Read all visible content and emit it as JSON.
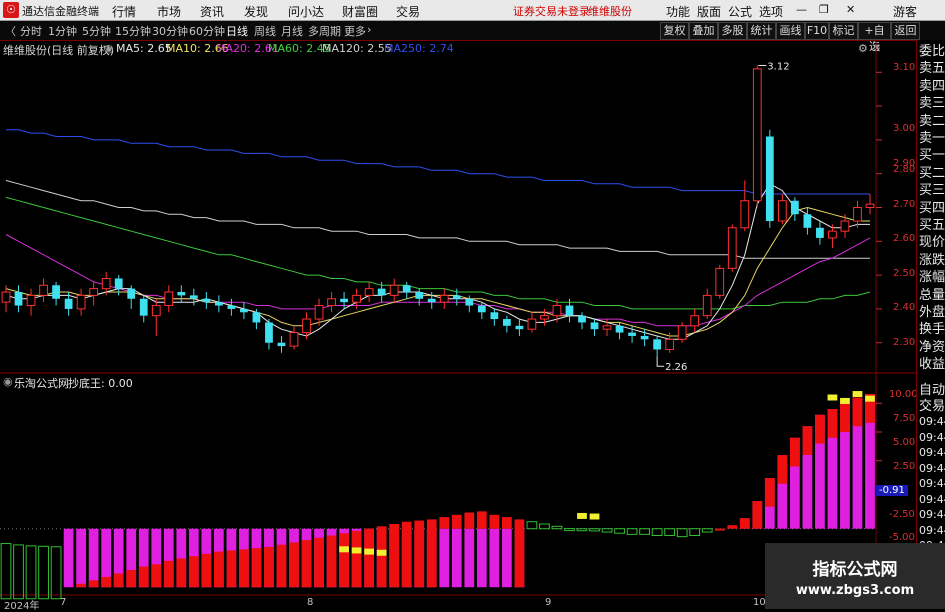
{
  "app": {
    "title": "通达信金融终端",
    "menus": [
      "行情",
      "市场",
      "资讯",
      "发现",
      "问小达",
      "财富圈",
      "交易"
    ],
    "warning": "证券交易未登录",
    "stock_name_top": "维维股份",
    "right_menus": [
      "功能",
      "版面",
      "公式",
      "选项"
    ],
    "user": "游客"
  },
  "toolbar": {
    "periods": [
      "分时",
      "1分钟",
      "5分钟",
      "15分钟",
      "30分钟",
      "60分钟",
      "日线",
      "周线",
      "月线",
      "多周期",
      "更多"
    ],
    "active": "日线",
    "buttons": [
      "复权",
      "叠加",
      "多股",
      "统计",
      "画线",
      "F10",
      "标记",
      "+自选",
      "返回"
    ]
  },
  "main_chart": {
    "header": "维维股份(日线 前复权)",
    "ma": [
      {
        "label": "MA5: 2.65",
        "color": "#e8e8e8"
      },
      {
        "label": "MA10: 2.66",
        "color": "#f0e060"
      },
      {
        "label": "MA20: 2.61",
        "color": "#e030e0"
      },
      {
        "label": "MA60: 2.45",
        "color": "#40d040"
      },
      {
        "label": "MA120: 2.55",
        "color": "#d0d0d0"
      },
      {
        "label": "MA250: 2.74",
        "color": "#3050f0"
      }
    ],
    "high_label": "3.12",
    "low_label": "2.26",
    "y_ticks": [
      "3.10",
      "3.00",
      "2.90",
      "2.80",
      "2.70",
      "2.60",
      "2.50",
      "2.40",
      "2.30"
    ]
  },
  "sub_chart": {
    "header_name": "乐淘公式网",
    "indicator": "抄底王: 0.00",
    "y_ticks": [
      "10.00",
      "7.50",
      "5.00",
      "2.50",
      "-0.91",
      "-2.50",
      "-5.00"
    ]
  },
  "x_axis": [
    "2024年",
    "7",
    "8",
    "9",
    "10"
  ],
  "right_panel": {
    "top_items": [
      "委比",
      "卖五",
      "卖四",
      "卖三",
      "卖二",
      "卖一",
      "买一",
      "买二",
      "买三",
      "买四",
      "买五",
      "现价",
      "涨跌",
      "涨幅",
      "总量",
      "外盘",
      "换手",
      "净资",
      "收益"
    ],
    "bottom_items": [
      "自动",
      "交易",
      "09:44",
      "09:44",
      "09:44",
      "09:44",
      "09:44",
      "09:44",
      "09:44",
      "09:44",
      "09:44"
    ]
  },
  "watermark": {
    "line1": "指标公式网",
    "line2": "www.zbgs3.com"
  },
  "chart_data": {
    "type": "candlestick",
    "title": "维维股份(日线 前复权)",
    "ylim": [
      2.24,
      3.16
    ],
    "candles": [
      [
        2.42,
        2.45,
        2.39,
        2.47
      ],
      [
        2.45,
        2.41,
        2.39,
        2.47
      ],
      [
        2.41,
        2.44,
        2.38,
        2.46
      ],
      [
        2.44,
        2.47,
        2.42,
        2.49
      ],
      [
        2.47,
        2.43,
        2.41,
        2.48
      ],
      [
        2.43,
        2.4,
        2.38,
        2.45
      ],
      [
        2.4,
        2.44,
        2.38,
        2.46
      ],
      [
        2.44,
        2.46,
        2.41,
        2.48
      ],
      [
        2.46,
        2.49,
        2.44,
        2.51
      ],
      [
        2.49,
        2.46,
        2.44,
        2.5
      ],
      [
        2.46,
        2.43,
        2.4,
        2.47
      ],
      [
        2.43,
        2.38,
        2.36,
        2.44
      ],
      [
        2.38,
        2.41,
        2.32,
        2.43
      ],
      [
        2.41,
        2.45,
        2.39,
        2.47
      ],
      [
        2.45,
        2.44,
        2.42,
        2.47
      ],
      [
        2.44,
        2.43,
        2.41,
        2.46
      ],
      [
        2.43,
        2.42,
        2.4,
        2.45
      ],
      [
        2.42,
        2.41,
        2.39,
        2.44
      ],
      [
        2.41,
        2.4,
        2.38,
        2.43
      ],
      [
        2.4,
        2.39,
        2.37,
        2.42
      ],
      [
        2.39,
        2.36,
        2.34,
        2.4
      ],
      [
        2.36,
        2.3,
        2.28,
        2.37
      ],
      [
        2.3,
        2.29,
        2.27,
        2.32
      ],
      [
        2.29,
        2.33,
        2.28,
        2.35
      ],
      [
        2.33,
        2.37,
        2.31,
        2.39
      ],
      [
        2.37,
        2.41,
        2.35,
        2.43
      ],
      [
        2.41,
        2.43,
        2.39,
        2.45
      ],
      [
        2.43,
        2.42,
        2.4,
        2.45
      ],
      [
        2.42,
        2.44,
        2.4,
        2.46
      ],
      [
        2.44,
        2.46,
        2.42,
        2.48
      ],
      [
        2.46,
        2.44,
        2.42,
        2.48
      ],
      [
        2.44,
        2.47,
        2.42,
        2.49
      ],
      [
        2.47,
        2.45,
        2.43,
        2.48
      ],
      [
        2.45,
        2.43,
        2.41,
        2.46
      ],
      [
        2.43,
        2.42,
        2.4,
        2.45
      ],
      [
        2.42,
        2.44,
        2.4,
        2.46
      ],
      [
        2.44,
        2.43,
        2.41,
        2.46
      ],
      [
        2.43,
        2.41,
        2.39,
        2.44
      ],
      [
        2.41,
        2.39,
        2.37,
        2.42
      ],
      [
        2.39,
        2.37,
        2.35,
        2.4
      ],
      [
        2.37,
        2.35,
        2.33,
        2.38
      ],
      [
        2.35,
        2.34,
        2.32,
        2.37
      ],
      [
        2.34,
        2.37,
        2.33,
        2.39
      ],
      [
        2.37,
        2.38,
        2.35,
        2.4
      ],
      [
        2.38,
        2.41,
        2.36,
        2.43
      ],
      [
        2.41,
        2.38,
        2.36,
        2.43
      ],
      [
        2.38,
        2.36,
        2.34,
        2.39
      ],
      [
        2.36,
        2.34,
        2.32,
        2.37
      ],
      [
        2.34,
        2.35,
        2.32,
        2.37
      ],
      [
        2.35,
        2.33,
        2.31,
        2.36
      ],
      [
        2.33,
        2.32,
        2.3,
        2.35
      ],
      [
        2.32,
        2.31,
        2.29,
        2.34
      ],
      [
        2.31,
        2.28,
        2.26,
        2.32
      ],
      [
        2.28,
        2.31,
        2.27,
        2.33
      ],
      [
        2.31,
        2.35,
        2.3,
        2.36
      ],
      [
        2.35,
        2.38,
        2.33,
        2.4
      ],
      [
        2.38,
        2.44,
        2.37,
        2.46
      ],
      [
        2.44,
        2.52,
        2.43,
        2.53
      ],
      [
        2.52,
        2.64,
        2.51,
        2.65
      ],
      [
        2.64,
        2.72,
        2.63,
        2.78
      ],
      [
        2.72,
        3.11,
        2.7,
        3.12
      ],
      [
        2.91,
        2.66,
        2.64,
        2.93
      ],
      [
        2.66,
        2.72,
        2.65,
        2.74
      ],
      [
        2.72,
        2.68,
        2.66,
        2.73
      ],
      [
        2.68,
        2.64,
        2.62,
        2.7
      ],
      [
        2.64,
        2.61,
        2.59,
        2.66
      ],
      [
        2.61,
        2.63,
        2.58,
        2.65
      ],
      [
        2.63,
        2.66,
        2.61,
        2.68
      ],
      [
        2.66,
        2.7,
        2.64,
        2.72
      ],
      [
        2.7,
        2.71,
        2.68,
        2.74
      ]
    ],
    "series": [
      {
        "name": "MA250",
        "values": [
          2.93,
          2.93,
          2.92,
          2.92,
          2.91,
          2.91,
          2.91,
          2.9,
          2.9,
          2.9,
          2.89,
          2.89,
          2.89,
          2.88,
          2.88,
          2.88,
          2.87,
          2.87,
          2.87,
          2.86,
          2.86,
          2.86,
          2.85,
          2.85,
          2.85,
          2.84,
          2.84,
          2.84,
          2.83,
          2.83,
          2.83,
          2.82,
          2.82,
          2.82,
          2.81,
          2.81,
          2.81,
          2.8,
          2.8,
          2.8,
          2.79,
          2.79,
          2.79,
          2.78,
          2.78,
          2.78,
          2.78,
          2.77,
          2.77,
          2.77,
          2.76,
          2.76,
          2.76,
          2.76,
          2.75,
          2.75,
          2.75,
          2.75,
          2.75,
          2.75,
          2.74,
          2.74,
          2.74,
          2.74,
          2.74,
          2.74,
          2.74,
          2.74,
          2.74,
          2.74
        ]
      },
      {
        "name": "MA120",
        "values": [
          2.78,
          2.77,
          2.76,
          2.75,
          2.74,
          2.73,
          2.72,
          2.72,
          2.71,
          2.7,
          2.7,
          2.69,
          2.69,
          2.68,
          2.68,
          2.67,
          2.67,
          2.66,
          2.66,
          2.66,
          2.65,
          2.65,
          2.65,
          2.64,
          2.64,
          2.64,
          2.63,
          2.63,
          2.63,
          2.62,
          2.62,
          2.62,
          2.62,
          2.61,
          2.61,
          2.61,
          2.61,
          2.6,
          2.6,
          2.6,
          2.6,
          2.59,
          2.59,
          2.59,
          2.59,
          2.58,
          2.58,
          2.58,
          2.58,
          2.57,
          2.57,
          2.57,
          2.57,
          2.56,
          2.56,
          2.56,
          2.56,
          2.56,
          2.56,
          2.55,
          2.55,
          2.55,
          2.55,
          2.55,
          2.55,
          2.55,
          2.55,
          2.55,
          2.55,
          2.55
        ]
      },
      {
        "name": "MA60",
        "values": [
          2.73,
          2.72,
          2.71,
          2.7,
          2.69,
          2.68,
          2.67,
          2.66,
          2.65,
          2.64,
          2.63,
          2.62,
          2.61,
          2.6,
          2.59,
          2.58,
          2.57,
          2.56,
          2.56,
          2.55,
          2.54,
          2.53,
          2.52,
          2.51,
          2.5,
          2.5,
          2.49,
          2.49,
          2.48,
          2.48,
          2.47,
          2.47,
          2.47,
          2.46,
          2.46,
          2.46,
          2.45,
          2.45,
          2.45,
          2.44,
          2.44,
          2.43,
          2.43,
          2.43,
          2.42,
          2.42,
          2.42,
          2.41,
          2.41,
          2.41,
          2.4,
          2.4,
          2.4,
          2.4,
          2.4,
          2.4,
          2.4,
          2.4,
          2.4,
          2.41,
          2.41,
          2.41,
          2.42,
          2.42,
          2.42,
          2.43,
          2.43,
          2.44,
          2.44,
          2.45
        ]
      },
      {
        "name": "MA20",
        "values": [
          2.62,
          2.6,
          2.58,
          2.56,
          2.54,
          2.52,
          2.5,
          2.48,
          2.47,
          2.46,
          2.45,
          2.44,
          2.44,
          2.43,
          2.43,
          2.43,
          2.42,
          2.42,
          2.42,
          2.42,
          2.41,
          2.41,
          2.4,
          2.4,
          2.4,
          2.4,
          2.41,
          2.41,
          2.41,
          2.41,
          2.42,
          2.42,
          2.42,
          2.42,
          2.42,
          2.42,
          2.42,
          2.42,
          2.41,
          2.41,
          2.4,
          2.4,
          2.39,
          2.39,
          2.39,
          2.38,
          2.38,
          2.37,
          2.37,
          2.37,
          2.36,
          2.36,
          2.35,
          2.35,
          2.35,
          2.35,
          2.36,
          2.37,
          2.39,
          2.41,
          2.44,
          2.46,
          2.48,
          2.5,
          2.52,
          2.54,
          2.55,
          2.57,
          2.59,
          2.61
        ]
      },
      {
        "name": "MA10",
        "values": [
          2.46,
          2.45,
          2.44,
          2.44,
          2.45,
          2.45,
          2.44,
          2.44,
          2.45,
          2.45,
          2.45,
          2.44,
          2.43,
          2.43,
          2.43,
          2.43,
          2.42,
          2.42,
          2.41,
          2.4,
          2.39,
          2.38,
          2.36,
          2.35,
          2.35,
          2.36,
          2.37,
          2.38,
          2.39,
          2.4,
          2.41,
          2.42,
          2.43,
          2.44,
          2.44,
          2.44,
          2.44,
          2.43,
          2.43,
          2.42,
          2.41,
          2.4,
          2.39,
          2.39,
          2.38,
          2.38,
          2.38,
          2.37,
          2.36,
          2.36,
          2.35,
          2.34,
          2.33,
          2.32,
          2.32,
          2.33,
          2.34,
          2.36,
          2.39,
          2.44,
          2.52,
          2.58,
          2.64,
          2.69,
          2.7,
          2.69,
          2.68,
          2.67,
          2.66,
          2.66
        ]
      },
      {
        "name": "MA5",
        "values": [
          2.44,
          2.43,
          2.43,
          2.44,
          2.44,
          2.44,
          2.43,
          2.44,
          2.45,
          2.46,
          2.46,
          2.44,
          2.42,
          2.42,
          2.42,
          2.42,
          2.43,
          2.42,
          2.41,
          2.4,
          2.39,
          2.36,
          2.34,
          2.33,
          2.32,
          2.34,
          2.37,
          2.4,
          2.42,
          2.44,
          2.44,
          2.45,
          2.45,
          2.45,
          2.44,
          2.43,
          2.43,
          2.43,
          2.42,
          2.4,
          2.39,
          2.37,
          2.36,
          2.36,
          2.37,
          2.38,
          2.38,
          2.37,
          2.36,
          2.35,
          2.34,
          2.33,
          2.32,
          2.31,
          2.31,
          2.33,
          2.35,
          2.4,
          2.47,
          2.56,
          2.71,
          2.77,
          2.75,
          2.7,
          2.68,
          2.66,
          2.64,
          2.64,
          2.65,
          2.65
        ]
      }
    ],
    "indicator": {
      "name": "抄底王",
      "ylim": [
        -6.5,
        11.5
      ],
      "zero_line": -0.91,
      "magenta": [
        0,
        0,
        0,
        0,
        0,
        -6.0,
        -6.0,
        -6.0,
        -6.0,
        -6.0,
        -6.0,
        -6.0,
        -6.0,
        -6.0,
        -6.0,
        -6.0,
        -6.0,
        -6.0,
        -6.0,
        -6.0,
        -6.0,
        -6.0,
        -6.0,
        -6.0,
        -6.0,
        -6.0,
        -6.0,
        -6.0,
        -6.0,
        -6.0,
        -6.0,
        -6.0,
        -6.0,
        -6.0,
        -6.0,
        -6.0,
        -6.0,
        -6.0,
        -6.0,
        -6.0,
        -6.0,
        -6.0,
        -6.0,
        -6.0,
        -6.0,
        -6.0,
        -6.0,
        -6.0,
        -6.0,
        -6.0,
        -6.0,
        -6.0,
        -6.0,
        -6.0,
        -6.0,
        -6.0,
        -6.0,
        -6.0,
        -6.0,
        -6.0,
        -6.0,
        -6.0,
        -6.0,
        -6.0,
        -6.0,
        -6.0,
        -6.0,
        -6.0,
        -6.0,
        -6.0
      ],
      "values": [
        -5.5,
        -5.8,
        -6.0,
        -6.1,
        -6.2,
        -6.0,
        -5.7,
        -5.4,
        -5.1,
        -4.8,
        -4.5,
        -4.2,
        -4.0,
        -3.7,
        -3.5,
        -3.3,
        -3.1,
        -2.9,
        -2.8,
        -2.7,
        -2.6,
        -2.5,
        -2.3,
        -2.1,
        -1.9,
        -1.7,
        -1.5,
        -1.3,
        -1.1,
        -0.9,
        -0.7,
        -0.5,
        -0.3,
        -0.2,
        -0.1,
        0.1,
        0.3,
        0.5,
        0.6,
        0.3,
        0.1,
        -0.1,
        -0.3,
        -0.5,
        -0.7,
        -0.9,
        -1.0,
        -1.1,
        -1.2,
        -1.3,
        -1.4,
        -1.4,
        -1.5,
        -1.5,
        -1.6,
        -1.5,
        -1.2,
        -0.9,
        -0.6,
        0.0,
        1.5,
        3.5,
        5.5,
        7.0,
        8.0,
        9.0,
        9.5,
        10.0,
        10.5,
        10.8
      ]
    }
  }
}
